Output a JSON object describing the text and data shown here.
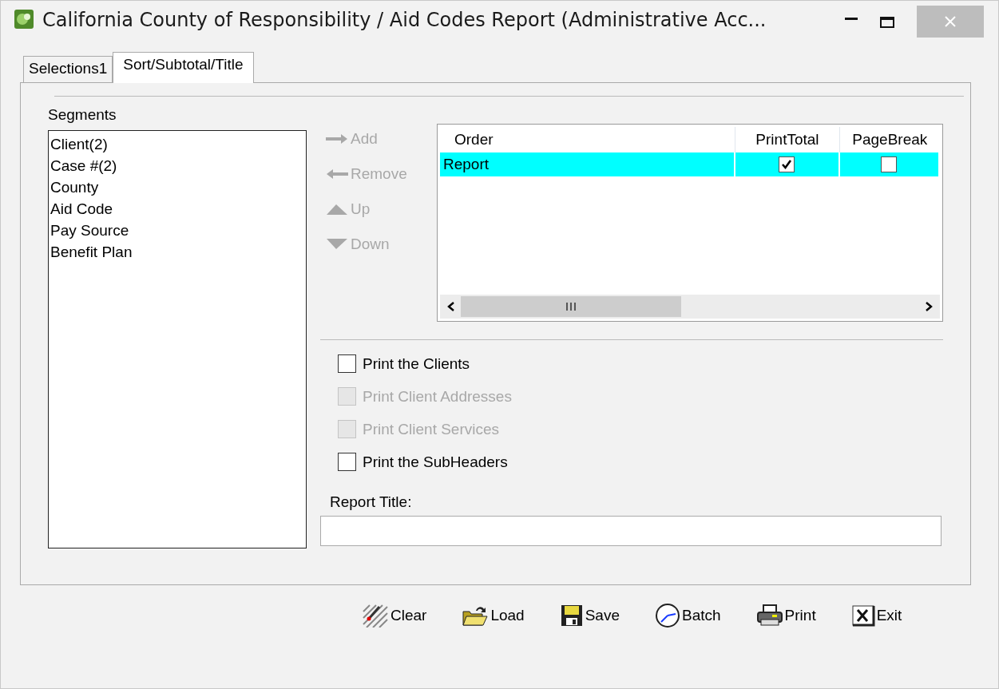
{
  "window": {
    "title": "California County of Responsibility / Aid Codes Report (Administrative Acc..."
  },
  "tabs": [
    {
      "label": "Selections1",
      "selected": false
    },
    {
      "label": "Sort/Subtotal/Title",
      "selected": true
    }
  ],
  "segments": {
    "label": "Segments",
    "items": [
      "Client(2)",
      "Case #(2)",
      "County",
      "Aid Code",
      "Pay Source",
      "Benefit Plan"
    ]
  },
  "move_buttons": [
    {
      "label": "Add",
      "kind": "right",
      "disabled": true
    },
    {
      "label": "Remove",
      "kind": "left",
      "disabled": true
    },
    {
      "label": "Up",
      "kind": "up",
      "disabled": true
    },
    {
      "label": "Down",
      "kind": "down",
      "disabled": true
    }
  ],
  "order_grid": {
    "columns": [
      "Order",
      "PrintTotal",
      "PageBreak"
    ],
    "rows": [
      {
        "order": "Report",
        "print_total": true,
        "page_break": false,
        "selected": true
      }
    ]
  },
  "options": [
    {
      "label": "Print the Clients",
      "checked": false,
      "disabled": false
    },
    {
      "label": "Print Client Addresses",
      "checked": false,
      "disabled": true
    },
    {
      "label": "Print Client Services",
      "checked": false,
      "disabled": true
    },
    {
      "label": "Print the SubHeaders",
      "checked": false,
      "disabled": false
    }
  ],
  "report_title": {
    "label": "Report Title:"
  },
  "buttons": [
    {
      "label": "Clear",
      "kind": "clear"
    },
    {
      "label": "Load",
      "kind": "load"
    },
    {
      "label": "Save",
      "kind": "save"
    },
    {
      "label": "Batch",
      "kind": "batch"
    },
    {
      "label": "Print",
      "kind": "print"
    },
    {
      "label": "Exit",
      "kind": "exit"
    }
  ]
}
